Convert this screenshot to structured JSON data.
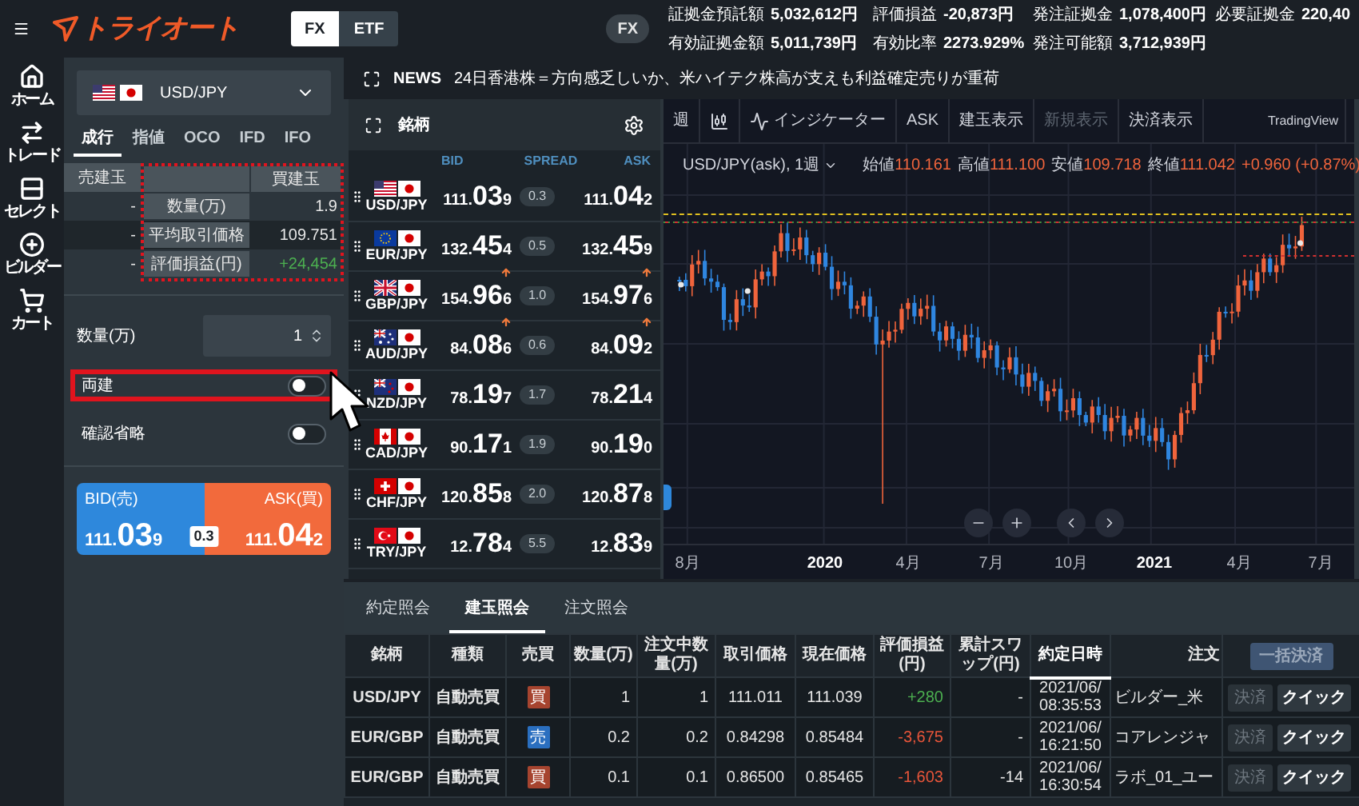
{
  "header": {
    "logo": "トライオート",
    "market_switch": [
      {
        "label": "FX",
        "selected": true
      },
      {
        "label": "ETF",
        "selected": false
      }
    ],
    "market_badge": "FX",
    "account_stats": [
      {
        "label": "証拠金預託額",
        "value": "5,032,612円"
      },
      {
        "label": "評価損益",
        "value": "-20,873円"
      },
      {
        "label": "発注証拠金",
        "value": "1,078,400円"
      },
      {
        "label": "必要証拠金",
        "value": "220,40"
      },
      {
        "label": "有効証拠金額",
        "value": "5,011,739円"
      },
      {
        "label": "有効比率",
        "value": "2273.929%"
      },
      {
        "label": "発注可能額",
        "value": "3,712,939円"
      }
    ]
  },
  "nav": [
    {
      "label": "ホーム"
    },
    {
      "label": "トレード"
    },
    {
      "label": "セレクト"
    },
    {
      "label": "ビルダー"
    },
    {
      "label": "カート"
    }
  ],
  "order_panel": {
    "pair": "USD/JPY",
    "order_tabs": [
      {
        "label": "成行",
        "selected": true
      },
      {
        "label": "指値",
        "selected": false
      },
      {
        "label": "OCO",
        "selected": false
      },
      {
        "label": "IFD",
        "selected": false
      },
      {
        "label": "IFO",
        "selected": false
      }
    ],
    "positions": {
      "sell_header": "売建玉",
      "buy_header": "買建玉",
      "highlighted": true,
      "rows": [
        {
          "label": "数量(万)",
          "sell": "-",
          "buy": "1.9",
          "color": "#e6e6e6"
        },
        {
          "label": "平均取引価格",
          "sell": "-",
          "buy": "109.751",
          "color": "#e6e6e6"
        },
        {
          "label": "評価損益(円)",
          "sell": "-",
          "buy": "+24,454",
          "color": "#4caf50"
        }
      ]
    },
    "quantity": {
      "label": "数量(万)",
      "value": "1"
    },
    "toggles": [
      {
        "label": "両建",
        "on": false,
        "highlighted": true
      },
      {
        "label": "確認省略",
        "on": false,
        "highlighted": false
      }
    ],
    "quote": {
      "bid_label": "BID(売)",
      "bid": {
        "lead": "111.",
        "pips": "03",
        "point": "9"
      },
      "spread": "0.3",
      "ask_label": "ASK(買)",
      "ask": {
        "lead": "111.",
        "pips": "04",
        "point": "2"
      }
    }
  },
  "news": {
    "label": "NEWS",
    "headline": "24日香港株＝方向感乏しいか、米ハイテク株高が支えも利益確定売りが重荷"
  },
  "rates": {
    "title": "銘柄",
    "columns": [
      "BID",
      "SPREAD",
      "ASK"
    ],
    "rows": [
      {
        "pair": "USD/JPY",
        "bid": {
          "lead": "111.",
          "pips": "03",
          "point": "9"
        },
        "spread": "0.3",
        "ask": {
          "lead": "111.",
          "pips": "04",
          "point": "2"
        },
        "rising": false
      },
      {
        "pair": "EUR/JPY",
        "bid": {
          "lead": "132.",
          "pips": "45",
          "point": "4"
        },
        "spread": "0.5",
        "ask": {
          "lead": "132.",
          "pips": "45",
          "point": "9"
        },
        "rising": false
      },
      {
        "pair": "GBP/JPY",
        "bid": {
          "lead": "154.",
          "pips": "96",
          "point": "6"
        },
        "spread": "1.0",
        "ask": {
          "lead": "154.",
          "pips": "97",
          "point": "6"
        },
        "rising": true
      },
      {
        "pair": "AUD/JPY",
        "bid": {
          "lead": "84.",
          "pips": "08",
          "point": "6"
        },
        "spread": "0.6",
        "ask": {
          "lead": "84.",
          "pips": "09",
          "point": "2"
        },
        "rising": true
      },
      {
        "pair": "NZD/JPY",
        "bid": {
          "lead": "78.",
          "pips": "19",
          "point": "7"
        },
        "spread": "1.7",
        "ask": {
          "lead": "78.",
          "pips": "21",
          "point": "4"
        },
        "rising": false
      },
      {
        "pair": "CAD/JPY",
        "bid": {
          "lead": "90.",
          "pips": "17",
          "point": "1"
        },
        "spread": "1.9",
        "ask": {
          "lead": "90.",
          "pips": "19",
          "point": "0"
        },
        "rising": false
      },
      {
        "pair": "CHF/JPY",
        "bid": {
          "lead": "120.",
          "pips": "85",
          "point": "8"
        },
        "spread": "2.0",
        "ask": {
          "lead": "120.",
          "pips": "87",
          "point": "8"
        },
        "rising": false
      },
      {
        "pair": "TRY/JPY",
        "bid": {
          "lead": "12.",
          "pips": "78",
          "point": "4"
        },
        "spread": "5.5",
        "ask": {
          "lead": "12.",
          "pips": "83",
          "point": "9"
        },
        "rising": false
      }
    ]
  },
  "chart": {
    "toolbar": [
      {
        "kind": "text",
        "label": "週",
        "disabled": false
      },
      {
        "kind": "icon",
        "disabled": false
      },
      {
        "kind": "indicator",
        "label": "インジケーター",
        "disabled": false
      },
      {
        "kind": "text",
        "label": "ASK",
        "disabled": false
      },
      {
        "kind": "text",
        "label": "建玉表示",
        "disabled": false
      },
      {
        "kind": "text",
        "label": "新規表示",
        "disabled": true
      },
      {
        "kind": "text",
        "label": "決済表示",
        "disabled": false
      }
    ],
    "brand": "TradingView",
    "legend": {
      "symbol": "USD/JPY(ask), 1週",
      "values": [
        {
          "label": "始値",
          "value": "110.161"
        },
        {
          "label": "高値",
          "value": "111.100"
        },
        {
          "label": "安値",
          "value": "109.718"
        },
        {
          "label": "終値",
          "value": "111.042"
        }
      ],
      "change": "+0.960 (+0.87%)"
    },
    "x_labels": [
      {
        "label": "8月",
        "kind": "month"
      },
      {
        "label": "2020",
        "kind": "year"
      },
      {
        "label": "4月",
        "kind": "month"
      },
      {
        "label": "7月",
        "kind": "month"
      },
      {
        "label": "10月",
        "kind": "month"
      },
      {
        "label": "2021",
        "kind": "year"
      },
      {
        "label": "4月",
        "kind": "month"
      },
      {
        "label": "7月",
        "kind": "month"
      }
    ]
  },
  "bottom": {
    "tabs": [
      {
        "label": "約定照会",
        "selected": false
      },
      {
        "label": "建玉照会",
        "selected": true
      },
      {
        "label": "注文照会",
        "selected": false
      }
    ],
    "columns": [
      {
        "label": "銘柄",
        "sorted": false
      },
      {
        "label": "種類",
        "sorted": false
      },
      {
        "label": "売買",
        "sorted": false
      },
      {
        "label": "数量(万)",
        "sorted": false
      },
      {
        "label": "注文中数量(万)",
        "sorted": false
      },
      {
        "label": "取引価格",
        "sorted": false
      },
      {
        "label": "現在価格",
        "sorted": false
      },
      {
        "label": "評価損益(円)",
        "sorted": false
      },
      {
        "label": "累計スワップ(円)",
        "sorted": false
      },
      {
        "label": "約定日時",
        "sorted": true
      },
      {
        "label": "注文",
        "sorted": false
      }
    ],
    "bulk_settle": {
      "label": "一括決済",
      "disabled": true
    },
    "rows": [
      {
        "pair": "USD/JPY",
        "type": "自動売買",
        "side": {
          "text": "買",
          "color": "#a6442f"
        },
        "qty": "1",
        "pending_qty": "1",
        "price": "111.011",
        "current": "111.039",
        "pl": {
          "text": "+280",
          "color": "#4caf50"
        },
        "swap": "-",
        "datetime": "2021/06/ 08:35:53",
        "order": "ビルダー_米",
        "settle": {
          "label": "決済",
          "disabled": true
        },
        "quick": "クイック"
      },
      {
        "pair": "EUR/GBP",
        "type": "自動売買",
        "side": {
          "text": "売",
          "color": "#2a6fc0"
        },
        "qty": "0.2",
        "pending_qty": "0.2",
        "price": "0.84298",
        "current": "0.85484",
        "pl": {
          "text": "-3,675",
          "color": "#e8553a"
        },
        "swap": "-",
        "datetime": "2021/06/ 16:21:50",
        "order": "コアレンジャ",
        "settle": {
          "label": "決済",
          "disabled": true
        },
        "quick": "クイック"
      },
      {
        "pair": "EUR/GBP",
        "type": "自動売買",
        "side": {
          "text": "買",
          "color": "#a6442f"
        },
        "qty": "0.1",
        "pending_qty": "0.1",
        "price": "0.86500",
        "current": "0.85465",
        "pl": {
          "text": "-1,603",
          "color": "#e8553a"
        },
        "swap": "-14",
        "datetime": "2021/06/ 16:30:54",
        "order": "ラボ_01_ユー",
        "settle": {
          "label": "決済",
          "disabled": true
        },
        "quick": "クイック"
      }
    ]
  }
}
